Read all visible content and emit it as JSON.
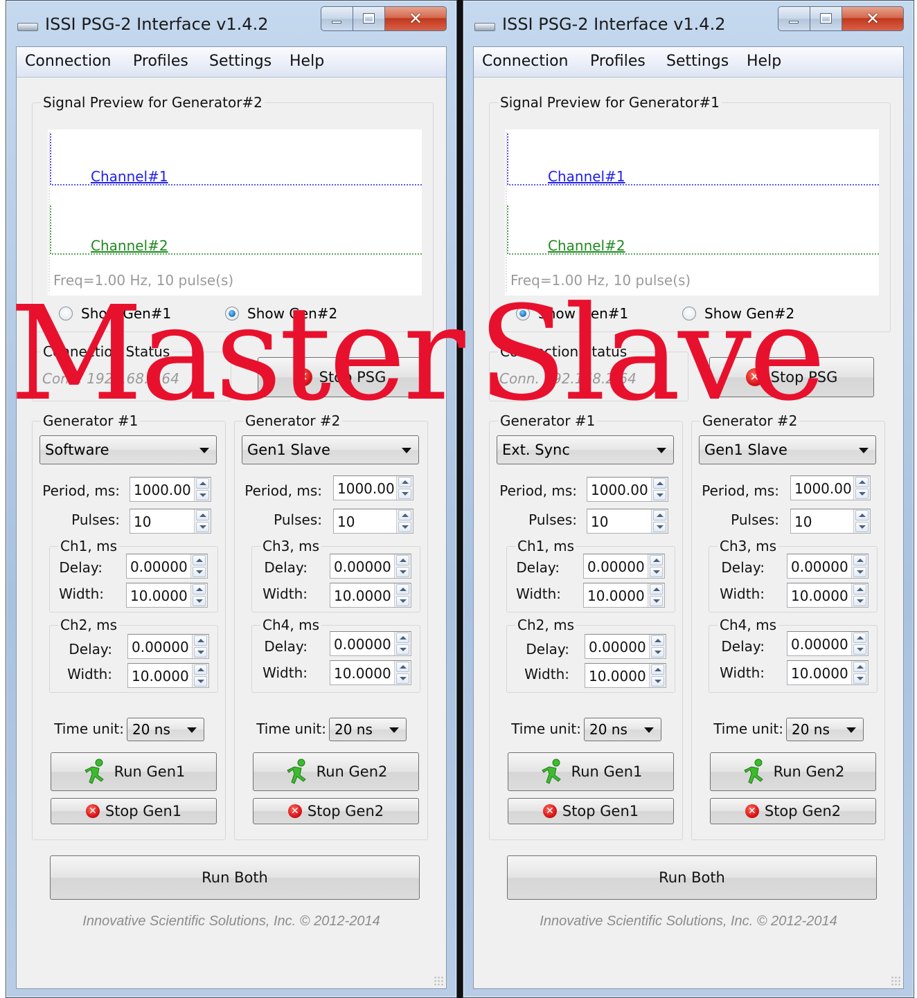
{
  "windows": [
    {
      "title": "ISSI PSG-2 Interface v1.4.2",
      "menu": [
        "Connection",
        "Profiles",
        "Settings",
        "Help"
      ],
      "preview": {
        "title": "Signal Preview for Generator#2",
        "ch1_label": "Channel#1",
        "ch2_label": "Channel#2",
        "freq": "Freq=1.00 Hz, 10 pulse(s)"
      },
      "radios": {
        "gen1_label": "Show Gen#1",
        "gen2_label": "Show Gen#2",
        "selected": "Show Gen#2"
      },
      "connection": {
        "title": "Connection Status",
        "status": "Conn. 192.168.1.64",
        "stop_psg": "Stop PSG"
      },
      "gen1": {
        "title": "Generator #1",
        "mode": "Software",
        "period_label": "Period, ms:",
        "period": "1000.00",
        "pulses_label": "Pulses:",
        "pulses": "10",
        "cha": {
          "title": "Ch1, ms",
          "delay_label": "Delay:",
          "delay": "0.00000",
          "width_label": "Width:",
          "width": "10.0000"
        },
        "chb": {
          "title": "Ch2, ms",
          "delay_label": "Delay:",
          "delay": "0.00000",
          "width_label": "Width:",
          "width": "10.0000"
        },
        "timeunit_label": "Time unit:",
        "timeunit": "20 ns",
        "run": "Run Gen1",
        "stop": "Stop Gen1"
      },
      "gen2": {
        "title": "Generator #2",
        "mode": "Gen1 Slave",
        "period_label": "Period, ms:",
        "period": "1000.00",
        "pulses_label": "Pulses:",
        "pulses": "10",
        "cha": {
          "title": "Ch3, ms",
          "delay_label": "Delay:",
          "delay": "0.00000",
          "width_label": "Width:",
          "width": "10.0000"
        },
        "chb": {
          "title": "Ch4, ms",
          "delay_label": "Delay:",
          "delay": "0.00000",
          "width_label": "Width:",
          "width": "10.0000"
        },
        "timeunit_label": "Time unit:",
        "timeunit": "20 ns",
        "run": "Run Gen2",
        "stop": "Stop Gen2"
      },
      "run_both": "Run Both",
      "footer": "Innovative Scientific Solutions, Inc. © 2012-2014",
      "overlay": "Master"
    },
    {
      "title": "ISSI PSG-2 Interface v1.4.2",
      "menu": [
        "Connection",
        "Profiles",
        "Settings",
        "Help"
      ],
      "preview": {
        "title": "Signal Preview for Generator#1",
        "ch1_label": "Channel#1",
        "ch2_label": "Channel#2",
        "freq": "Freq=1.00 Hz, 10 pulse(s)"
      },
      "radios": {
        "gen1_label": "Show Gen#1",
        "gen2_label": "Show Gen#2",
        "selected": "Show Gen#1"
      },
      "connection": {
        "title": "Connection Status",
        "status": "Conn. 192.168.2.64",
        "stop_psg": "Stop PSG"
      },
      "gen1": {
        "title": "Generator #1",
        "mode": "Ext. Sync",
        "period_label": "Period, ms:",
        "period": "1000.00",
        "pulses_label": "Pulses:",
        "pulses": "10",
        "cha": {
          "title": "Ch1, ms",
          "delay_label": "Delay:",
          "delay": "0.00000",
          "width_label": "Width:",
          "width": "10.0000"
        },
        "chb": {
          "title": "Ch2, ms",
          "delay_label": "Delay:",
          "delay": "0.00000",
          "width_label": "Width:",
          "width": "10.0000"
        },
        "timeunit_label": "Time unit:",
        "timeunit": "20 ns",
        "run": "Run Gen1",
        "stop": "Stop Gen1"
      },
      "gen2": {
        "title": "Generator #2",
        "mode": "Gen1 Slave",
        "period_label": "Period, ms:",
        "period": "1000.00",
        "pulses_label": "Pulses:",
        "pulses": "10",
        "cha": {
          "title": "Ch3, ms",
          "delay_label": "Delay:",
          "delay": "0.00000",
          "width_label": "Width:",
          "width": "10.0000"
        },
        "chb": {
          "title": "Ch4, ms",
          "delay_label": "Delay:",
          "delay": "0.00000",
          "width_label": "Width:",
          "width": "10.0000"
        },
        "timeunit_label": "Time unit:",
        "timeunit": "20 ns",
        "run": "Run Gen2",
        "stop": "Stop Gen2"
      },
      "run_both": "Run Both",
      "footer": "Innovative Scientific Solutions, Inc. © 2012-2014",
      "overlay": "Slave"
    }
  ],
  "colors": {
    "channel1": "#2020ee",
    "channel2": "#1e8a1e",
    "overlay_text": "#e8112d",
    "stop_icon": "#d8161a",
    "run_icon": "#3dbb2e"
  },
  "icons": {
    "stop": "stop-circle-x-icon",
    "run": "running-man-icon",
    "close": "close-icon",
    "minimize": "minimize-icon",
    "maximize": "maximize-icon"
  }
}
